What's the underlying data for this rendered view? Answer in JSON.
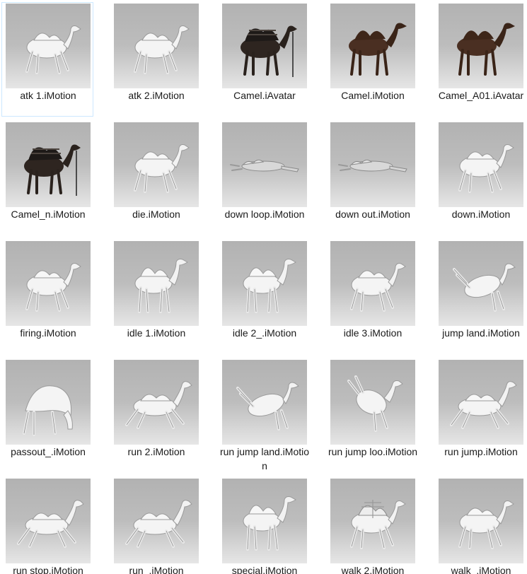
{
  "window": {
    "view": "Large icons"
  },
  "selected_index": 0,
  "files": [
    {
      "name": "atk 1.iMotion",
      "icon": "camel-white-walk-thumbnail"
    },
    {
      "name": "atk 2.iMotion",
      "icon": "camel-white-walk-thumbnail"
    },
    {
      "name": "Camel.iAvatar",
      "icon": "camel-saddled-dark-thumbnail"
    },
    {
      "name": "Camel.iMotion",
      "icon": "camel-brown-thumbnail"
    },
    {
      "name": "Camel_A01.iAvatar",
      "icon": "camel-brown-thumbnail"
    },
    {
      "name": "Camel_n.iMotion",
      "icon": "camel-saddled-dark-thumbnail"
    },
    {
      "name": "die.iMotion",
      "icon": "camel-white-walk-thumbnail"
    },
    {
      "name": "down loop.iMotion",
      "icon": "camel-lying-thumbnail"
    },
    {
      "name": "down out.iMotion",
      "icon": "camel-lying-thumbnail"
    },
    {
      "name": "down.iMotion",
      "icon": "camel-white-walk-thumbnail"
    },
    {
      "name": "firing.iMotion",
      "icon": "camel-white-walk-thumbnail"
    },
    {
      "name": "idle 1.iMotion",
      "icon": "camel-white-standing-thumbnail"
    },
    {
      "name": "idle 2_.iMotion",
      "icon": "camel-white-standing-thumbnail"
    },
    {
      "name": "idle 3.iMotion",
      "icon": "camel-white-walk-thumbnail"
    },
    {
      "name": "jump land.iMotion",
      "icon": "camel-white-jump-thumbnail"
    },
    {
      "name": "passout_.iMotion",
      "icon": "camel-white-bent-thumbnail"
    },
    {
      "name": "run 2.iMotion",
      "icon": "camel-white-run-thumbnail"
    },
    {
      "name": "run jump land.iMotion",
      "icon": "camel-white-jump-thumbnail"
    },
    {
      "name": "run jump loo.iMotion",
      "icon": "camel-white-rear-thumbnail"
    },
    {
      "name": "run jump.iMotion",
      "icon": "camel-white-run-thumbnail"
    },
    {
      "name": "run stop.iMotion",
      "icon": "camel-white-run-thumbnail"
    },
    {
      "name": "run_.iMotion",
      "icon": "camel-white-run-thumbnail"
    },
    {
      "name": "special.iMotion",
      "icon": "camel-white-standing-thumbnail"
    },
    {
      "name": "walk 2.iMotion",
      "icon": "camel-white-saddle-walk-thumbnail"
    },
    {
      "name": "walk_.iMotion",
      "icon": "camel-white-walk-thumbnail"
    }
  ]
}
